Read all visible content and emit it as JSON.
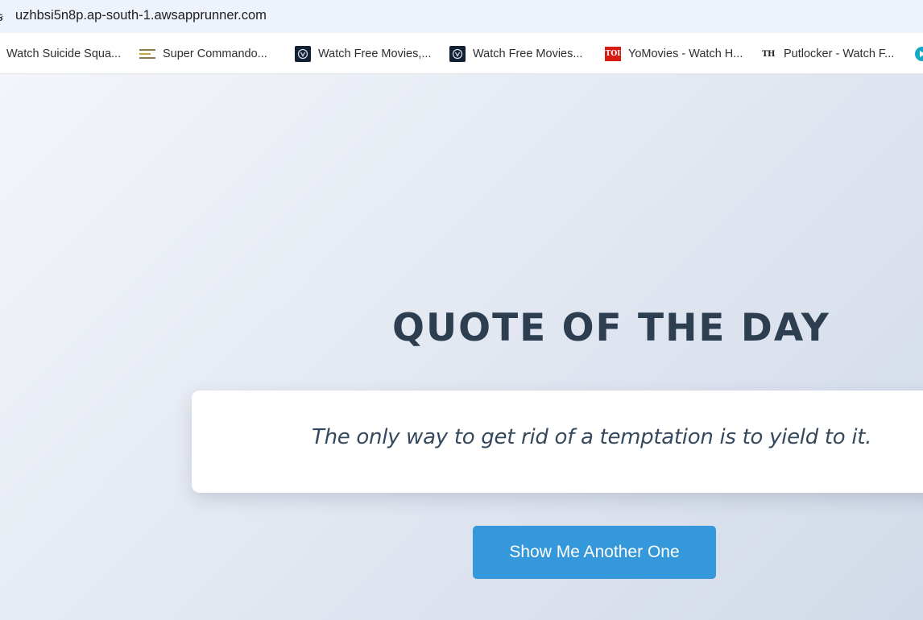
{
  "browser": {
    "url": "uzhbsi5n8p.ap-south-1.awsapprunner.com",
    "bookmarks": [
      {
        "label": "Watch Suicide Squa...",
        "icon": "none"
      },
      {
        "label": "Super Commando...",
        "icon": "site-logo-icon"
      },
      {
        "label": "Watch Free Movies,...",
        "icon": "movie-site-icon"
      },
      {
        "label": "Watch Free Movies...",
        "icon": "movie-site-icon"
      },
      {
        "label": "YoMovies - Watch H...",
        "icon": "toi-icon",
        "icon_text": "TOI"
      },
      {
        "label": "Putlocker - Watch F...",
        "icon": "th-icon",
        "icon_text": "TH"
      }
    ]
  },
  "page": {
    "title": "QUOTE OF THE DAY",
    "quote": "The only way to get rid of a temptation is to yield to it.",
    "button_label": "Show Me Another One"
  },
  "colors": {
    "title": "#2c3e50",
    "quote_text": "#34495e",
    "button_bg": "#3498db",
    "button_text": "#ffffff",
    "background": "#e4e9f2"
  }
}
